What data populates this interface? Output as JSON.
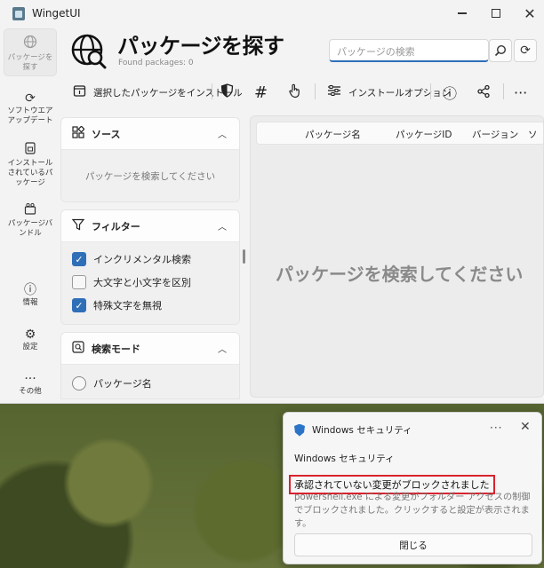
{
  "window": {
    "title": "WingetUI",
    "minimize": "—",
    "maximize": "",
    "close": "✕"
  },
  "nav": {
    "items": [
      {
        "label": "パッケージを探す",
        "icon": "globe-icon"
      },
      {
        "label": "ソフトウエアアップデート",
        "icon": "refresh-icon"
      },
      {
        "label": "インストールされているパッケージ",
        "icon": "installed-icon"
      },
      {
        "label": "パッケージバンドル",
        "icon": "bundle-icon"
      },
      {
        "label": "情報",
        "icon": "info-icon"
      },
      {
        "label": "設定",
        "icon": "gear-icon"
      },
      {
        "label": "その他",
        "icon": "more-icon"
      }
    ]
  },
  "header": {
    "title": "パッケージを探す",
    "found": "Found packages: 0",
    "search_placeholder": "パッケージの検索"
  },
  "toolbar": {
    "install_selected": "選択したパッケージをインストール",
    "install_options": "インストールオプション"
  },
  "sources": {
    "title": "ソース",
    "empty": "パッケージを検索してください"
  },
  "filters": {
    "title": "フィルター",
    "items": [
      {
        "label": "インクリメンタル検索",
        "checked": true
      },
      {
        "label": "大文字と小文字を区別",
        "checked": false
      },
      {
        "label": "特殊文字を無視",
        "checked": true
      }
    ]
  },
  "search_mode": {
    "title": "検索モード",
    "option": "パッケージ名"
  },
  "table": {
    "columns": [
      "パッケージ名",
      "パッケージID",
      "バージョン",
      "ソ"
    ],
    "empty": "パッケージを検索してください"
  },
  "toast": {
    "app": "Windows セキュリティ",
    "header": "Windows セキュリティ",
    "title": "承認されていない変更がブロックされました",
    "body": "powershell.exe による変更がフォルダー アクセスの制御でブロックされました。クリックすると設定が表示されます。",
    "button": "閉じる",
    "dots": "···",
    "close": "✕"
  },
  "colors": {
    "accent": "#2f6fb8",
    "highlight": "#d9232e"
  }
}
